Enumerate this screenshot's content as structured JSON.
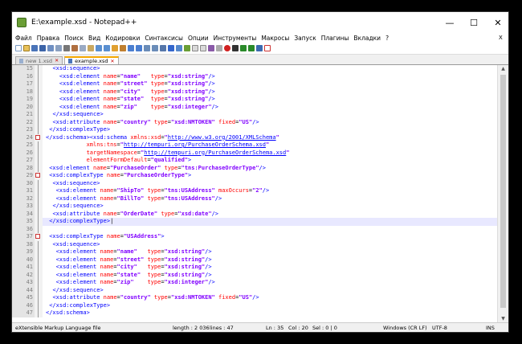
{
  "window": {
    "title": "E:\\example.xsd - Notepad++",
    "minimize": "—",
    "maximize": "☐",
    "close": "✕"
  },
  "menu": [
    "Файл",
    "Правка",
    "Поиск",
    "Вид",
    "Кодировки",
    "Синтаксисы",
    "Опции",
    "Инструменты",
    "Макросы",
    "Запуск",
    "Плагины",
    "Вкладки",
    "?"
  ],
  "menu_close": "X",
  "tabs": [
    {
      "label": "new 1.xsd",
      "close": "✕"
    },
    {
      "label": "example.xsd",
      "close": "✕"
    }
  ],
  "editor": {
    "lines": [
      {
        "n": "15",
        "html": "  <span class=\"t\">&lt;xsd:sequence&gt;</span>"
      },
      {
        "n": "16",
        "html": "    <span class=\"t\">&lt;xsd:element</span> <span class=\"a\">name</span>=<span class=\"s\">\"name\"</span>   <span class=\"a\">type</span>=<span class=\"s\">\"xsd:string\"</span><span class=\"t\">/&gt;</span>"
      },
      {
        "n": "17",
        "html": "    <span class=\"t\">&lt;xsd:element</span> <span class=\"a\">name</span>=<span class=\"s\">\"street\"</span> <span class=\"a\">type</span>=<span class=\"s\">\"xsd:string\"</span><span class=\"t\">/&gt;</span>"
      },
      {
        "n": "18",
        "html": "    <span class=\"t\">&lt;xsd:element</span> <span class=\"a\">name</span>=<span class=\"s\">\"city\"</span>   <span class=\"a\">type</span>=<span class=\"s\">\"xsd:string\"</span><span class=\"t\">/&gt;</span>"
      },
      {
        "n": "19",
        "html": "    <span class=\"t\">&lt;xsd:element</span> <span class=\"a\">name</span>=<span class=\"s\">\"state\"</span>  <span class=\"a\">type</span>=<span class=\"s\">\"xsd:string\"</span><span class=\"t\">/&gt;</span>"
      },
      {
        "n": "20",
        "html": "    <span class=\"t\">&lt;xsd:element</span> <span class=\"a\">name</span>=<span class=\"s\">\"zip\"</span>    <span class=\"a\">type</span>=<span class=\"s\">\"xsd:integer\"</span><span class=\"t\">/&gt;</span>"
      },
      {
        "n": "21",
        "html": "  <span class=\"t\">&lt;/xsd:sequence&gt;</span>"
      },
      {
        "n": "22",
        "html": "  <span class=\"t\">&lt;xsd:attribute</span> <span class=\"a\">name</span>=<span class=\"s\">\"country\"</span> <span class=\"a\">type</span>=<span class=\"s\">\"xsd:NMTOKEN\"</span> <span class=\"a\">fixed</span>=<span class=\"s\">\"US\"</span><span class=\"t\">/&gt;</span>"
      },
      {
        "n": "23",
        "html": " <span class=\"t\">&lt;/xsd:complexType&gt;</span>"
      },
      {
        "n": "24",
        "html": "<span class=\"t\">&lt;/xsd:schema&gt;&lt;xsd:schema</span> <span class=\"a\">xmlns:xsd</span>=<span class=\"s\">\"</span><span class=\"u\">http://www.w3.org/2001/XMLSchema</span><span class=\"s\">\"</span>"
      },
      {
        "n": "25",
        "html": "            <span class=\"a\">xmlns:tns</span>=<span class=\"s\">\"</span><span class=\"u\">http://tempuri.org/PurchaseOrderSchema.xsd</span><span class=\"s\">\"</span>"
      },
      {
        "n": "26",
        "html": "            <span class=\"a\">targetNamespace</span>=<span class=\"s\">\"</span><span class=\"u\">http://tempuri.org/PurchaseOrderSchema.xsd</span><span class=\"s\">\"</span>"
      },
      {
        "n": "27",
        "html": "            <span class=\"a\">elementFormDefault</span>=<span class=\"s\">\"qualified\"</span><span class=\"t\">&gt;</span>"
      },
      {
        "n": "28",
        "html": " <span class=\"t\">&lt;xsd:element</span> <span class=\"a\">name</span>=<span class=\"s\">\"PurchaseOrder\"</span> <span class=\"a\">type</span>=<span class=\"s\">\"tns:PurchaseOrderType\"</span><span class=\"t\">/&gt;</span>"
      },
      {
        "n": "29",
        "html": " <span class=\"t\">&lt;xsd:complexType</span> <span class=\"a\">name</span>=<span class=\"s\">\"PurchaseOrderType\"</span><span class=\"t\">&gt;</span>"
      },
      {
        "n": "30",
        "html": "  <span class=\"t\">&lt;xsd:sequence&gt;</span>"
      },
      {
        "n": "31",
        "html": "   <span class=\"t\">&lt;xsd:element</span> <span class=\"a\">name</span>=<span class=\"s\">\"ShipTo\"</span> <span class=\"a\">type</span>=<span class=\"s\">\"tns:USAddress\"</span> <span class=\"a\">maxOccurs</span>=<span class=\"s\">\"2\"</span><span class=\"t\">/&gt;</span>"
      },
      {
        "n": "32",
        "html": "   <span class=\"t\">&lt;xsd:element</span> <span class=\"a\">name</span>=<span class=\"s\">\"BillTo\"</span> <span class=\"a\">type</span>=<span class=\"s\">\"tns:USAddress\"</span><span class=\"t\">/&gt;</span>"
      },
      {
        "n": "33",
        "html": "  <span class=\"t\">&lt;/xsd:sequence&gt;</span>"
      },
      {
        "n": "34",
        "html": "  <span class=\"t\">&lt;xsd:attribute</span> <span class=\"a\">name</span>=<span class=\"s\">\"OrderDate\"</span> <span class=\"a\">type</span>=<span class=\"s\">\"xsd:date\"</span><span class=\"t\">/&gt;</span>"
      },
      {
        "n": "35",
        "html": " <span class=\"t\">&lt;/xsd:complexType&gt;</span><span class=\"p\">|</span>"
      },
      {
        "n": "36",
        "html": ""
      },
      {
        "n": "37",
        "html": " <span class=\"t\">&lt;xsd:complexType</span> <span class=\"a\">name</span>=<span class=\"s\">\"USAddress\"</span><span class=\"t\">&gt;</span>"
      },
      {
        "n": "38",
        "html": "  <span class=\"t\">&lt;xsd:sequence&gt;</span>"
      },
      {
        "n": "39",
        "html": "   <span class=\"t\">&lt;xsd:element</span> <span class=\"a\">name</span>=<span class=\"s\">\"name\"</span>   <span class=\"a\">type</span>=<span class=\"s\">\"xsd:string\"</span><span class=\"t\">/&gt;</span>"
      },
      {
        "n": "40",
        "html": "   <span class=\"t\">&lt;xsd:element</span> <span class=\"a\">name</span>=<span class=\"s\">\"street\"</span> <span class=\"a\">type</span>=<span class=\"s\">\"xsd:string\"</span><span class=\"t\">/&gt;</span>"
      },
      {
        "n": "41",
        "html": "   <span class=\"t\">&lt;xsd:element</span> <span class=\"a\">name</span>=<span class=\"s\">\"city\"</span>   <span class=\"a\">type</span>=<span class=\"s\">\"xsd:string\"</span><span class=\"t\">/&gt;</span>"
      },
      {
        "n": "42",
        "html": "   <span class=\"t\">&lt;xsd:element</span> <span class=\"a\">name</span>=<span class=\"s\">\"state\"</span>  <span class=\"a\">type</span>=<span class=\"s\">\"xsd:string\"</span><span class=\"t\">/&gt;</span>"
      },
      {
        "n": "43",
        "html": "   <span class=\"t\">&lt;xsd:element</span> <span class=\"a\">name</span>=<span class=\"s\">\"zip\"</span>    <span class=\"a\">type</span>=<span class=\"s\">\"xsd:integer\"</span><span class=\"t\">/&gt;</span>"
      },
      {
        "n": "44",
        "html": "  <span class=\"t\">&lt;/xsd:sequence&gt;</span>"
      },
      {
        "n": "45",
        "html": "  <span class=\"t\">&lt;xsd:attribute</span> <span class=\"a\">name</span>=<span class=\"s\">\"country\"</span> <span class=\"a\">type</span>=<span class=\"s\">\"xsd:NMTOKEN\"</span> <span class=\"a\">fixed</span>=<span class=\"s\">\"US\"</span><span class=\"t\">/&gt;</span>"
      },
      {
        "n": "46",
        "html": " <span class=\"t\">&lt;/xsd:complexType&gt;</span>"
      },
      {
        "n": "47",
        "html": "<span class=\"t\">&lt;/xsd:schema&gt;</span>"
      }
    ],
    "current_line": "35",
    "fold_marks": [
      "24",
      "29",
      "37"
    ]
  },
  "status": {
    "filetype": "eXtensible Markup Language file",
    "length": "length : 2 036",
    "lines": "lines : 47",
    "ln": "Ln : 35",
    "col": "Col : 20",
    "sel": "Sel : 0 | 0",
    "eol": "Windows (CR LF)",
    "encoding": "UTF-8",
    "mode": "INS"
  },
  "colors": {
    "tag": "#0000ff",
    "attr": "#ff0000",
    "string": "#8000ff"
  }
}
